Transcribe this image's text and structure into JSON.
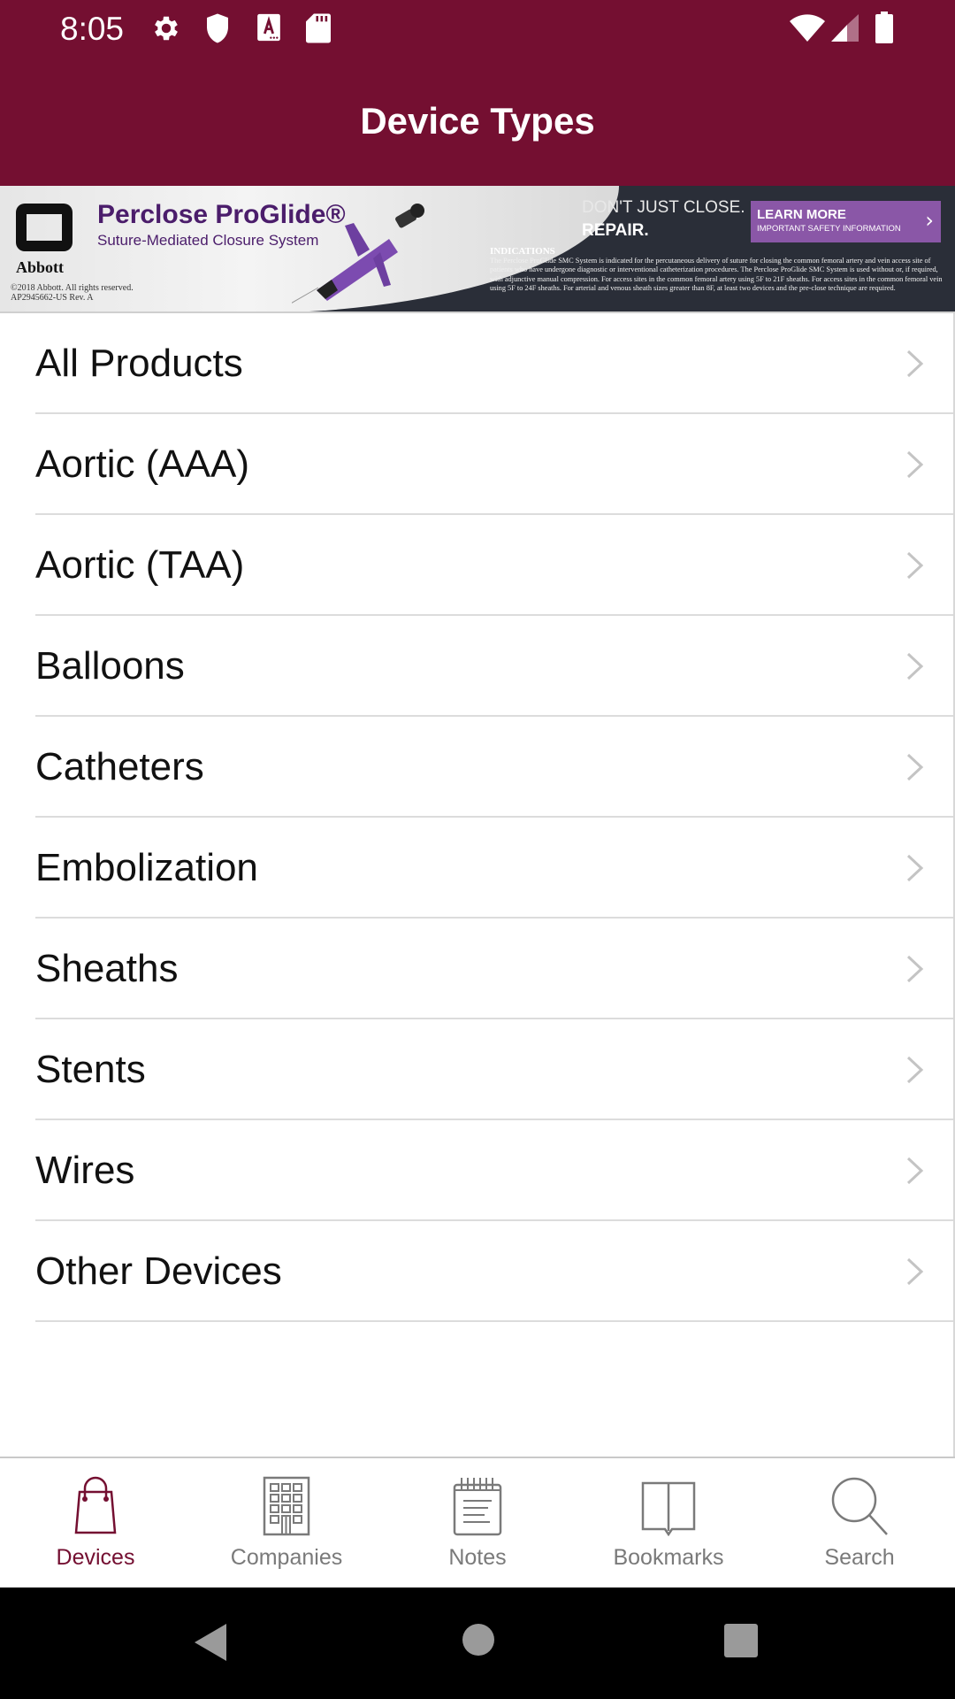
{
  "status_bar": {
    "time": "8:05",
    "left_icons": [
      "gear-icon",
      "shield-icon",
      "font-a-icon",
      "sd-card-icon"
    ],
    "right_icons": [
      "wifi-icon",
      "cell-signal-icon",
      "battery-icon"
    ]
  },
  "appbar": {
    "title": "Device Types",
    "color": "#740f31"
  },
  "ad": {
    "company": "Abbott",
    "brand": "Perclose ProGlide®",
    "subtitle": "Suture-Mediated Closure System",
    "device_label": "ProGlide",
    "copyright_line1": "©2018 Abbott. All rights reserved.",
    "copyright_line2": "AP2945662-US Rev. A",
    "tagline1": "DON'T JUST CLOSE.",
    "tagline2": "REPAIR.",
    "cta_main": "LEARN MORE",
    "cta_sub": "IMPORTANT SAFETY INFORMATION",
    "cta_chevron": "›",
    "indications_title": "INDICATIONS",
    "indications_body": "The Perclose ProGlide SMC System is indicated for the percutaneous delivery of suture for closing the common femoral artery and vein access site of patients who have undergone diagnostic or interventional catheterization procedures. The Perclose ProGlide SMC System is used without or, if required, with adjunctive manual compression. For access sites in the common femoral artery using 5F to 21F sheaths. For access sites in the common femoral vein using 5F to 24F sheaths. For arterial and venous sheath sizes greater than 8F, at least two devices and the pre-close technique are required."
  },
  "list": {
    "items": [
      {
        "label": "All Products"
      },
      {
        "label": "Aortic (AAA)"
      },
      {
        "label": "Aortic (TAA)"
      },
      {
        "label": "Balloons"
      },
      {
        "label": "Catheters"
      },
      {
        "label": "Embolization"
      },
      {
        "label": "Sheaths"
      },
      {
        "label": "Stents"
      },
      {
        "label": "Wires"
      },
      {
        "label": "Other Devices"
      }
    ]
  },
  "bottom_nav": {
    "active_color": "#740f31",
    "inactive_color": "#7a7a7a",
    "tabs": [
      {
        "label": "Devices",
        "icon": "shopping-bag-icon",
        "active": true
      },
      {
        "label": "Companies",
        "icon": "building-icon",
        "active": false
      },
      {
        "label": "Notes",
        "icon": "notepad-icon",
        "active": false
      },
      {
        "label": "Bookmarks",
        "icon": "book-icon",
        "active": false
      },
      {
        "label": "Search",
        "icon": "search-icon",
        "active": false
      }
    ]
  },
  "system_nav": {
    "buttons": [
      "back",
      "home",
      "recents"
    ]
  }
}
